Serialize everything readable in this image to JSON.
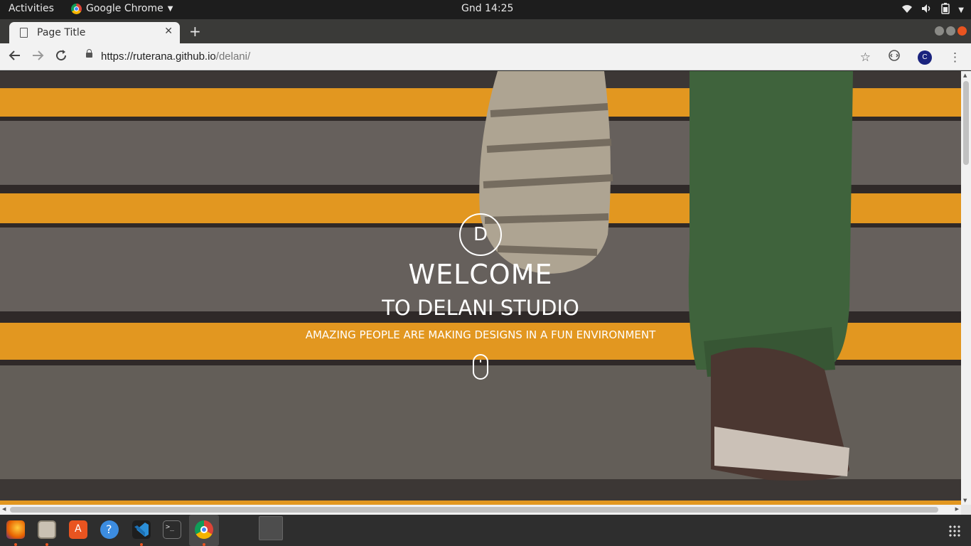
{
  "system_bar": {
    "activities": "Activities",
    "app_name": "Google Chrome",
    "clock": "Gnd 14:25"
  },
  "browser": {
    "tab_title": "Page Title",
    "url_host": "https://ruterana.github.io",
    "url_path": "/delani/",
    "profile_initial": "C"
  },
  "hero": {
    "logo_letter": "D",
    "heading": "WELCOME",
    "subheading": "TO DELANI STUDIO",
    "tagline": "AMAZING PEOPLE ARE MAKING DESIGNS IN A FUN ENVIRONMENT"
  },
  "colors": {
    "stair_orange": "#f0a21e",
    "stair_gray": "#5f5c54",
    "ubuntu_orange": "#e95420",
    "profile_blue": "#1a237e"
  },
  "dock": {
    "apps": [
      "firefox-icon",
      "files-icon",
      "software-icon",
      "help-icon",
      "vscode-icon",
      "terminal-icon",
      "chrome-icon",
      "document-icon"
    ]
  }
}
